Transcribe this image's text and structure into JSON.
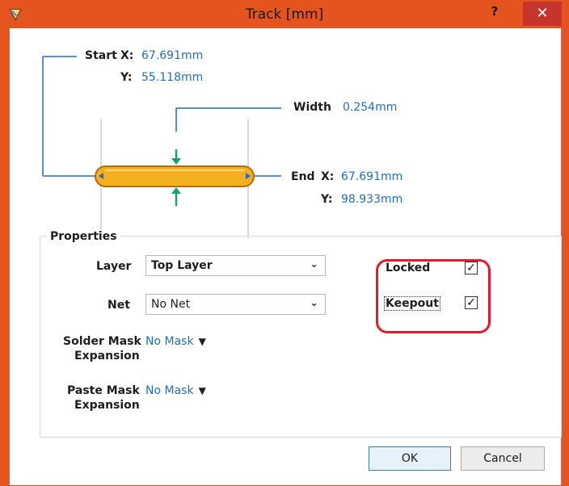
{
  "window": {
    "title": "Track [mm]",
    "help_label": "?",
    "close_label": "✕"
  },
  "diagram": {
    "start_label": "Start",
    "start_x_label": "X:",
    "start_x": "67.691mm",
    "start_y_label": "Y:",
    "start_y": "55.118mm",
    "width_label": "Width",
    "width": "0.254mm",
    "end_label": "End",
    "end_x_label": "X:",
    "end_x": "67.691mm",
    "end_y_label": "Y:",
    "end_y": "98.933mm"
  },
  "properties": {
    "title": "Properties",
    "layer_label": "Layer",
    "layer_value": "Top Layer",
    "net_label": "Net",
    "net_value": "No Net",
    "solder_label_1": "Solder Mask",
    "solder_label_2": "Expansion",
    "solder_value": "No Mask",
    "paste_label_1": "Paste Mask",
    "paste_label_2": "Expansion",
    "paste_value": "No Mask",
    "locked_label": "Locked",
    "locked_checked": true,
    "keepout_label": "Keepout",
    "keepout_checked": true
  },
  "buttons": {
    "ok": "OK",
    "cancel": "Cancel"
  },
  "colors": {
    "titlebar": "#e3541f",
    "value_blue": "#1f6fc0",
    "track_fill": "#f5b021",
    "highlight_red": "#e01b2b"
  }
}
